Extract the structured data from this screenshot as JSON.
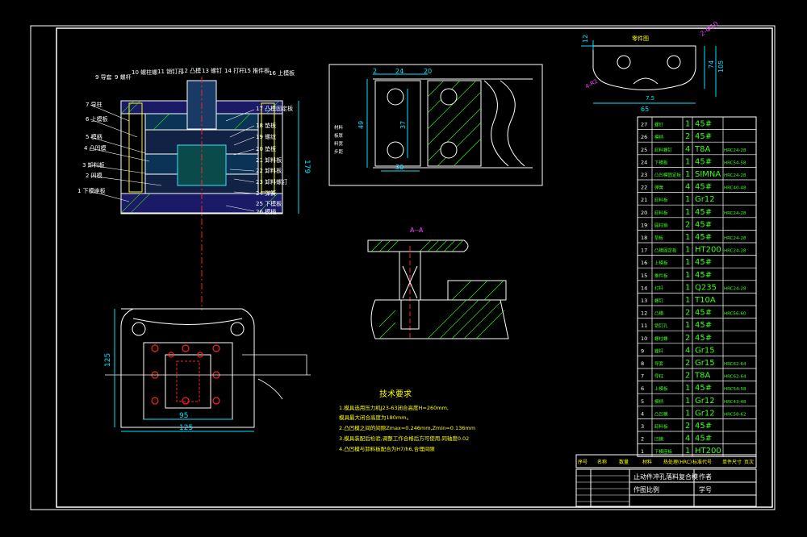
{
  "colors": {
    "background": "#000000",
    "frame": "#ffffff",
    "dim": "#00e5ff",
    "green": "#39ff14",
    "yellow": "#ffff00",
    "magenta": "#ff40ff",
    "red": "#ff2020",
    "blue": "#3060ff",
    "cyan": "#40e0ff"
  },
  "assembly_view": {
    "labels": [
      "9 导套",
      "9 螺杆",
      "10 螺柱螺",
      "11 销钉孔",
      "12 凸模",
      "13 螺钉",
      "14 打杆",
      "15 推件板",
      "16 上模板",
      "7 导柱",
      "6 上模板",
      "5 模柄",
      "4 凸凹模",
      "3 卸料板",
      "2 凹模",
      "1 下模座板",
      "17 凸模固定板",
      "18 垫板",
      "19 螺纹",
      "20 垫板",
      "21 卸料板",
      "22 卸料板",
      "23 卸料螺钉",
      "24 弹簧",
      "25 下模板",
      "26 模柄"
    ],
    "height_dim": "179"
  },
  "bottom_view": {
    "width_inner": "95",
    "width_outer": "125",
    "height": "125"
  },
  "strip_layout": {
    "dims": [
      "24",
      "2",
      "20",
      "49",
      "37",
      "30"
    ],
    "note_lines": [
      "材料",
      "板厚",
      "料宽",
      "步距"
    ]
  },
  "blank_part": {
    "title": "零件图",
    "dims": [
      "12",
      "2-Ф10",
      "74",
      "105",
      "65",
      "4-R2",
      "7.5"
    ]
  },
  "section_label": "A--A",
  "tech_requirements": {
    "title": "技术要求",
    "items": [
      "1.模具选用压力机J23-63闭合高度H=260mm,",
      "  模具最大闭合高度为180mm。",
      "2.凸凹模之间的间隙Zmax=0.246mm,Zmin=0.136mm",
      "3.模具装配后检验,调整工作合格后方可使用,同轴度0.02",
      "4.凸凹模与卸料板配合为H7/h6,合理间隙"
    ]
  },
  "bom": [
    {
      "no": "27",
      "name": "螺钉",
      "qty": "1",
      "mat": "45#",
      "note": ""
    },
    {
      "no": "26",
      "name": "模柄",
      "qty": "2",
      "mat": "45#",
      "note": ""
    },
    {
      "no": "25",
      "name": "卸料螺钉",
      "qty": "4",
      "mat": "T8A",
      "note": "HRC24-28"
    },
    {
      "no": "24",
      "name": "下模板",
      "qty": "1",
      "mat": "45#",
      "note": "HRC54-58"
    },
    {
      "no": "23",
      "name": "凸凹模固定板",
      "qty": "1",
      "mat": "SIMNA",
      "note": "HRC24-28"
    },
    {
      "no": "22",
      "name": "弹簧",
      "qty": "4",
      "mat": "45#",
      "note": "HRC40-48"
    },
    {
      "no": "21",
      "name": "卸料板",
      "qty": "1",
      "mat": "Gr12",
      "note": ""
    },
    {
      "no": "20",
      "name": "卸料板",
      "qty": "1",
      "mat": "45#",
      "note": "HRC24-28"
    },
    {
      "no": "19",
      "name": "圆柱销",
      "qty": "2",
      "mat": "45#",
      "note": ""
    },
    {
      "no": "18",
      "name": "垫板",
      "qty": "1",
      "mat": "45#",
      "note": "HRC24-28"
    },
    {
      "no": "17",
      "name": "凸模固定板",
      "qty": "1",
      "mat": "HT200",
      "note": "HRC24-28"
    },
    {
      "no": "16",
      "name": "上模板",
      "qty": "1",
      "mat": "45#",
      "note": ""
    },
    {
      "no": "15",
      "name": "推件板",
      "qty": "1",
      "mat": "45#",
      "note": ""
    },
    {
      "no": "14",
      "name": "打杆",
      "qty": "1",
      "mat": "Q235",
      "note": "HRC24-28"
    },
    {
      "no": "13",
      "name": "螺钉",
      "qty": "1",
      "mat": "T10A",
      "note": ""
    },
    {
      "no": "12",
      "name": "凸模",
      "qty": "2",
      "mat": "45#",
      "note": "HRC56-60"
    },
    {
      "no": "11",
      "name": "销钉孔",
      "qty": "1",
      "mat": "45#",
      "note": ""
    },
    {
      "no": "10",
      "name": "螺柱螺",
      "qty": "2",
      "mat": "45#",
      "note": ""
    },
    {
      "no": "9",
      "name": "螺杆",
      "qty": "4",
      "mat": "Gr15",
      "note": ""
    },
    {
      "no": "8",
      "name": "导套",
      "qty": "2",
      "mat": "Gr15",
      "note": "HRC62-64"
    },
    {
      "no": "7",
      "name": "导柱",
      "qty": "2",
      "mat": "T8A",
      "note": "HRC62-64"
    },
    {
      "no": "6",
      "name": "上模板",
      "qty": "1",
      "mat": "45#",
      "note": "HRC54-58"
    },
    {
      "no": "5",
      "name": "模柄",
      "qty": "1",
      "mat": "Gr12",
      "note": "HRC43-48"
    },
    {
      "no": "4",
      "name": "凸凹模",
      "qty": "1",
      "mat": "Gr12",
      "note": "HRC58-62"
    },
    {
      "no": "3",
      "name": "卸料板",
      "qty": "2",
      "mat": "45#",
      "note": ""
    },
    {
      "no": "2",
      "name": "凹模",
      "qty": "4",
      "mat": "45#",
      "note": ""
    },
    {
      "no": "1",
      "name": "下模座板",
      "qty": "1",
      "mat": "HT200",
      "note": ""
    }
  ],
  "bom_header": [
    "序号",
    "名称",
    "数量",
    "材料",
    "热处理(HRC)",
    "标准代号",
    "单件尺寸",
    "页次"
  ],
  "title_block": {
    "drawing_name": "止动件冲孔落料复合模",
    "scale_label": "作图比例",
    "author_label": "作者",
    "id_label": "学号"
  }
}
